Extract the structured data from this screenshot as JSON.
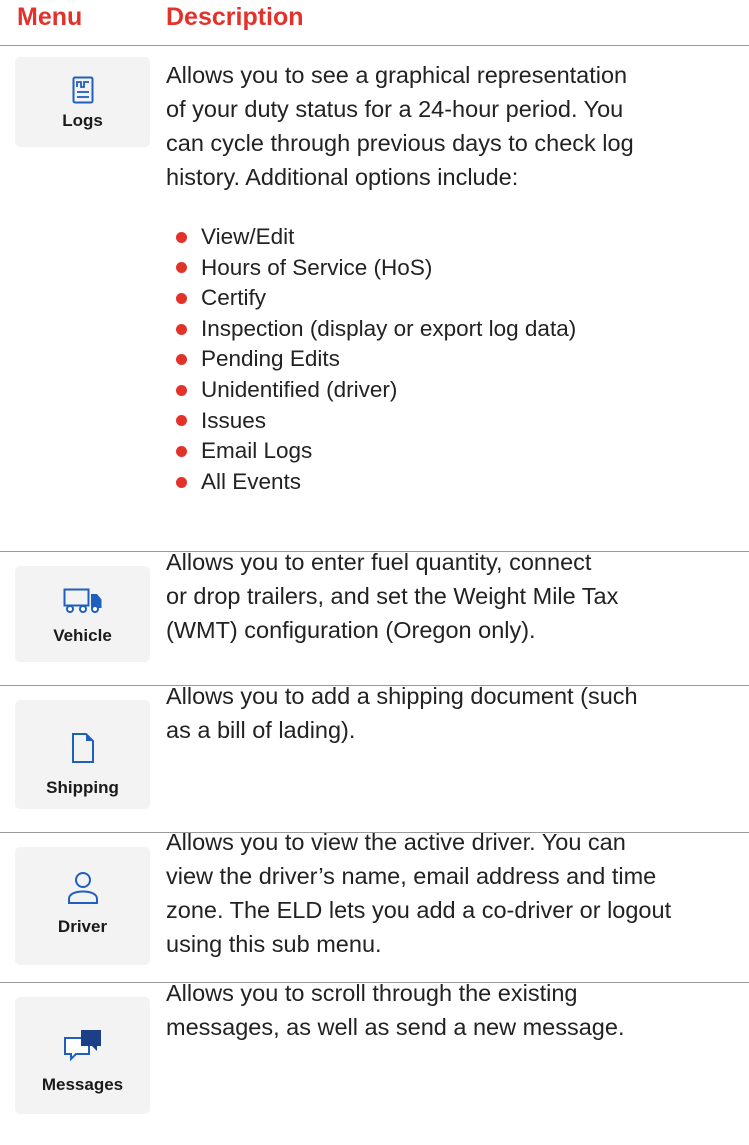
{
  "header": {
    "menu_label": "Menu",
    "description_label": "Description"
  },
  "colors": {
    "accent": "#e4322b",
    "icon_blue": "#1f5fbf",
    "icon_navy": "#1c3f87",
    "divider": "#9a9a9a"
  },
  "rows": [
    {
      "label": "Logs",
      "icon": "log-chart-icon",
      "description": [
        "Allows you to see a graphical representation",
        "of your duty status for a 24-hour period. You",
        "can cycle through previous days to check log",
        "history. Additional options include:"
      ],
      "options": [
        "View/Edit",
        "Hours of Service (HoS)",
        "Certify",
        "Inspection (display or export log data)",
        "Pending Edits",
        "Unidentified (driver)",
        "Issues",
        "Email Logs",
        "All Events"
      ]
    },
    {
      "label": "Vehicle",
      "icon": "truck-icon",
      "description": [
        "Allows you to enter fuel quantity, connect",
        "or drop trailers, and set the Weight Mile Tax",
        "(WMT) configuration (Oregon only)."
      ]
    },
    {
      "label": "Shipping",
      "icon": "document-icon",
      "description": [
        "Allows you to add a shipping document (such",
        "as a bill of lading)."
      ]
    },
    {
      "label": "Driver",
      "icon": "person-icon",
      "description": [
        "Allows you to view the active driver. You can",
        "view the driver’s name, email address and time",
        "zone. The ELD lets you add a co-driver or logout",
        "using this sub menu."
      ]
    },
    {
      "label": "Messages",
      "icon": "chat-bubbles-icon",
      "description": [
        "Allows you to scroll through the existing",
        "messages, as well as send a new message."
      ]
    }
  ]
}
